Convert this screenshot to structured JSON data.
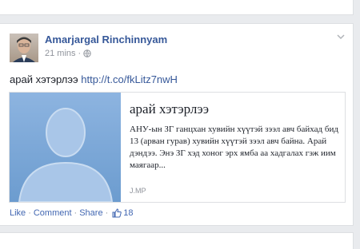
{
  "post": {
    "author": "Amarjargal Rinchinnyam",
    "time": "21 mins",
    "separator": "·",
    "text": "арай хэтэрлээ",
    "link": "http://t.co/fkLitz7nwH"
  },
  "share": {
    "title": "арай хэтэрлээ",
    "description": "АНУ-ын ЗГ ганцхан хувийн хүүтэй зээл авч байхад бид 13 (арван гурав) хувийн хүүтэй зээл авч байна. Арай дэндээ. Энэ ЗГ хэд хоног эрх ямба аа хадгалах гэж иим маягаар...",
    "domain": "J.MP"
  },
  "actions": {
    "like": "Like",
    "comment": "Comment",
    "share": "Share",
    "dot": "·",
    "like_count": "18"
  },
  "colors": {
    "link": "#365899",
    "thumb": "#7aa7d6"
  },
  "icons": {
    "privacy": "globe-icon",
    "options": "chevron-down-icon",
    "like": "thumbs-up-icon"
  }
}
